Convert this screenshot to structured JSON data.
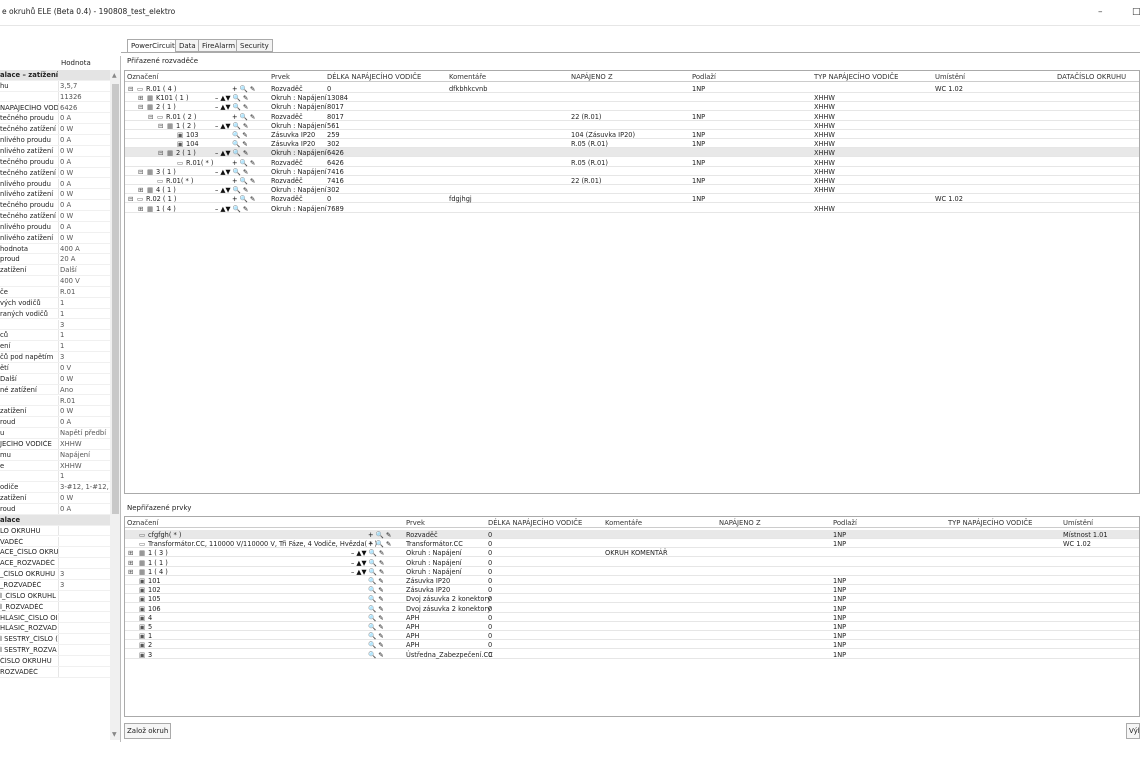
{
  "window": {
    "title": "e okruhů ELE (Beta 0.4) - 190808_test_elektro",
    "min": "–",
    "max": "□"
  },
  "tabs": [
    "PowerCircuit",
    "Data",
    "FireAlarm",
    "Security"
  ],
  "assigned_label": "Přiřazené rozvaděče",
  "unassigned_label": "Nepřiřazené prvky",
  "buttons": {
    "create_circuit": "Založ okruh",
    "right": "Výb"
  },
  "left": {
    "col_value": "Hodnota",
    "rows": [
      {
        "k": "alace – zatížení",
        "v": "",
        "cat": true
      },
      {
        "k": "hu",
        "v": "3,5,7"
      },
      {
        "k": "",
        "v": "11326"
      },
      {
        "k": "NAPÁJECÍHO VODIČ",
        "v": "6426"
      },
      {
        "k": "tečného proudu",
        "v": "0 A"
      },
      {
        "k": "tečného zatížení",
        "v": "0 W"
      },
      {
        "k": "nlivého proudu",
        "v": "0 A"
      },
      {
        "k": "nlivého zatížení",
        "v": "0 W"
      },
      {
        "k": "tečného proudu",
        "v": "0 A"
      },
      {
        "k": "tečného zatížení",
        "v": "0 W"
      },
      {
        "k": "nlivého proudu",
        "v": "0 A"
      },
      {
        "k": "nlivého zatížení",
        "v": "0 W"
      },
      {
        "k": "tečného proudu",
        "v": "0 A"
      },
      {
        "k": "tečného zatížení",
        "v": "0 W"
      },
      {
        "k": "nlivého proudu",
        "v": "0 A"
      },
      {
        "k": "nlivého zatížení",
        "v": "0 W"
      },
      {
        "k": "hodnota",
        "v": "400 A"
      },
      {
        "k": "proud",
        "v": "20 A"
      },
      {
        "k": "zatížení",
        "v": "Další"
      },
      {
        "k": "",
        "v": "400 V"
      },
      {
        "k": "če",
        "v": "R.01"
      },
      {
        "k": "vých vodičů",
        "v": "1"
      },
      {
        "k": "raných vodičů",
        "v": "1"
      },
      {
        "k": "",
        "v": "3"
      },
      {
        "k": "ců",
        "v": "1"
      },
      {
        "k": "ení",
        "v": "1"
      },
      {
        "k": "čů pod napětím",
        "v": "3"
      },
      {
        "k": "ětí",
        "v": "0 V"
      },
      {
        "k": "Další",
        "v": "0 W"
      },
      {
        "k": "né zatížení",
        "v": "Ano"
      },
      {
        "k": "",
        "v": "R.01"
      },
      {
        "k": "zatížení",
        "v": "0 W"
      },
      {
        "k": "roud",
        "v": "0 A"
      },
      {
        "k": "u",
        "v": "Napětí předbí"
      },
      {
        "k": "JECÍHO VODIČE",
        "v": "XHHW"
      },
      {
        "k": "mu",
        "v": "Napájení"
      },
      {
        "k": "e",
        "v": "XHHW"
      },
      {
        "k": "",
        "v": "1"
      },
      {
        "k": "odiče",
        "v": "3-#12, 1-#12,"
      },
      {
        "k": "zatížení",
        "v": "0 W"
      },
      {
        "k": "roud",
        "v": "0 A"
      },
      {
        "k": "alace",
        "v": "",
        "cat": true
      },
      {
        "k": "LO OKRUHU",
        "v": ""
      },
      {
        "k": "VADĚČ",
        "v": ""
      },
      {
        "k": "ACE_ČÍSLO OKRUL",
        "v": ""
      },
      {
        "k": "ACE_ROZVADĚČ",
        "v": ""
      },
      {
        "k": "_ČÍSLO OKRUHU",
        "v": "3"
      },
      {
        "k": "_ROZVADĚČ",
        "v": "3"
      },
      {
        "k": "Í_ČÍSLO OKRUHL",
        "v": ""
      },
      {
        "k": "Í_ROZVADĚČ",
        "v": ""
      },
      {
        "k": "HLÁSIČ_ČÍSLO OI",
        "v": ""
      },
      {
        "k": "HLÁSIČ_ROZVAD",
        "v": ""
      },
      {
        "k": "Í SESTRY_ČÍSLO (",
        "v": ""
      },
      {
        "k": "Í SESTRY_ROZVA",
        "v": ""
      },
      {
        "k": "ČÍSLO OKRUHU",
        "v": ""
      },
      {
        "k": "ROZVADĚČ",
        "v": ""
      }
    ]
  },
  "assigned": {
    "headers": [
      "Označení",
      "Prvek",
      "DÉLKA NAPÁJECÍHO VODIČE",
      "Komentáře",
      "NAPÁJENO Z",
      "Podlaží",
      "TYP NAPÁJECÍHO VODIČE",
      "Umístění",
      "DATAČÍSLO OKRUHU"
    ],
    "rows": [
      {
        "ind": 0,
        "exp": "⊟",
        "icon": "▭",
        "name": "R.01 ( 4 )",
        "ctrl": "+ 🔍 ✎",
        "prvek": "Rozvaděč",
        "delka": "0",
        "kom": "dfkbhkcvnb",
        "nap": "",
        "pod": "1NP",
        "typ": "",
        "um": "WC 1.02"
      },
      {
        "ind": 1,
        "exp": "⊞",
        "icon": "▦",
        "name": "K101 ( 1 )",
        "ctrl": "– ▲▼ 🔍 ✎",
        "prvek": "Okruh : Napájení",
        "delka": "13084",
        "kom": "",
        "nap": "",
        "pod": "",
        "typ": "XHHW",
        "um": ""
      },
      {
        "ind": 1,
        "exp": "⊟",
        "icon": "▦",
        "name": "2 ( 1 )",
        "ctrl": "– ▲▼ 🔍 ✎",
        "prvek": "Okruh : Napájení",
        "delka": "8017",
        "kom": "",
        "nap": "",
        "pod": "",
        "typ": "XHHW",
        "um": ""
      },
      {
        "ind": 2,
        "exp": "⊟",
        "icon": "▭",
        "name": "R.01 ( 2 )",
        "ctrl": "+ 🔍 ✎",
        "prvek": "Rozvaděč",
        "delka": "8017",
        "kom": "",
        "nap": "22 (R.01)",
        "pod": "1NP",
        "typ": "XHHW",
        "um": ""
      },
      {
        "ind": 3,
        "exp": "⊟",
        "icon": "▦",
        "name": "1 ( 2 )",
        "ctrl": "– ▲▼ 🔍 ✎",
        "prvek": "Okruh : Napájení",
        "delka": "561",
        "kom": "",
        "nap": "",
        "pod": "",
        "typ": "XHHW",
        "um": ""
      },
      {
        "ind": 4,
        "exp": "",
        "icon": "▣",
        "name": "103",
        "ctrl": "🔍 ✎",
        "prvek": "Zásuvka IP20",
        "delka": "259",
        "kom": "",
        "nap": "104 (Zásuvka IP20)",
        "pod": "1NP",
        "typ": "XHHW",
        "um": ""
      },
      {
        "ind": 4,
        "exp": "",
        "icon": "▣",
        "name": "104",
        "ctrl": "🔍 ✎",
        "prvek": "Zásuvka IP20",
        "delka": "302",
        "kom": "",
        "nap": "R.05 (R.01)",
        "pod": "1NP",
        "typ": "XHHW",
        "um": ""
      },
      {
        "ind": 3,
        "exp": "⊟",
        "icon": "▦",
        "name": "2 ( 1 )",
        "ctrl": "– ▲▼ 🔍 ✎",
        "prvek": "Okruh : Napájení",
        "delka": "6426",
        "kom": "",
        "nap": "",
        "pod": "",
        "typ": "XHHW",
        "um": "",
        "sel": true
      },
      {
        "ind": 4,
        "exp": "",
        "icon": "▭",
        "name": "R.01( * )",
        "ctrl": "+ 🔍 ✎",
        "prvek": "Rozvaděč",
        "delka": "6426",
        "kom": "",
        "nap": "R.05 (R.01)",
        "pod": "1NP",
        "typ": "XHHW",
        "um": ""
      },
      {
        "ind": 1,
        "exp": "⊟",
        "icon": "▦",
        "name": "3 ( 1 )",
        "ctrl": "– ▲▼ 🔍 ✎",
        "prvek": "Okruh : Napájení",
        "delka": "7416",
        "kom": "",
        "nap": "",
        "pod": "",
        "typ": "XHHW",
        "um": ""
      },
      {
        "ind": 2,
        "exp": "",
        "icon": "▭",
        "name": "R.01( * )",
        "ctrl": "+ 🔍 ✎",
        "prvek": "Rozvaděč",
        "delka": "7416",
        "kom": "",
        "nap": "22 (R.01)",
        "pod": "1NP",
        "typ": "XHHW",
        "um": ""
      },
      {
        "ind": 1,
        "exp": "⊞",
        "icon": "▦",
        "name": "4 ( 1 )",
        "ctrl": "– ▲▼ 🔍 ✎",
        "prvek": "Okruh : Napájení",
        "delka": "302",
        "kom": "",
        "nap": "",
        "pod": "",
        "typ": "XHHW",
        "um": ""
      },
      {
        "ind": 0,
        "exp": "⊟",
        "icon": "▭",
        "name": "R.02 ( 1 )",
        "ctrl": "+ 🔍 ✎",
        "prvek": "Rozvaděč",
        "delka": "0",
        "kom": "fdgjhgj",
        "nap": "",
        "pod": "1NP",
        "typ": "",
        "um": "WC 1.02"
      },
      {
        "ind": 1,
        "exp": "⊞",
        "icon": "▦",
        "name": "1 ( 4 )",
        "ctrl": "– ▲▼ 🔍 ✎",
        "prvek": "Okruh : Napájení",
        "delka": "7689",
        "kom": "",
        "nap": "",
        "pod": "",
        "typ": "XHHW",
        "um": ""
      }
    ]
  },
  "unassigned": {
    "headers": [
      "Označení",
      "Prvek",
      "DÉLKA NAPÁJECÍHO VODIČE",
      "Komentáře",
      "NAPÁJENO Z",
      "Podlaží",
      "TYP NAPÁJECÍHO VODIČE",
      "Umístění"
    ],
    "rows": [
      {
        "exp": "",
        "icon": "▭",
        "name": "cfgfgh( * )",
        "ctrl": "+ 🔍 ✎",
        "prvek": "Rozvaděč",
        "delka": "0",
        "kom": "",
        "pod": "1NP",
        "um": "Místnost 1.01",
        "sel": true
      },
      {
        "exp": "",
        "icon": "▭",
        "name": "Transformátor.CC, 110000 V/110000 V, Tři Fáze, 4 Vodiče, Hvězda( * )",
        "ctrl": "+ 🔍 ✎",
        "prvek": "Transformátor.CC",
        "delka": "0",
        "kom": "",
        "pod": "1NP",
        "um": "WC 1.02"
      },
      {
        "exp": "⊞",
        "icon": "▦",
        "name": "1 ( 3 )",
        "ctrl": "– ▲▼ 🔍 ✎",
        "prvek": "Okruh : Napájení",
        "delka": "0",
        "kom": "OKRUH KOMENTÁŘ",
        "pod": "",
        "um": ""
      },
      {
        "exp": "⊞",
        "icon": "▦",
        "name": "1 ( 1 )",
        "ctrl": "– ▲▼ 🔍 ✎",
        "prvek": "Okruh : Napájení",
        "delka": "0",
        "kom": "",
        "pod": "",
        "um": ""
      },
      {
        "exp": "⊞",
        "icon": "▦",
        "name": "1 ( 4 )",
        "ctrl": "– ▲▼ 🔍 ✎",
        "prvek": "Okruh : Napájení",
        "delka": "0",
        "kom": "",
        "pod": "",
        "um": ""
      },
      {
        "exp": "",
        "icon": "▣",
        "name": "101",
        "ctrl": "🔍 ✎",
        "prvek": "Zásuvka IP20",
        "delka": "0",
        "kom": "",
        "pod": "1NP",
        "um": ""
      },
      {
        "exp": "",
        "icon": "▣",
        "name": "102",
        "ctrl": "🔍 ✎",
        "prvek": "Zásuvka IP20",
        "delka": "0",
        "kom": "",
        "pod": "1NP",
        "um": ""
      },
      {
        "exp": "",
        "icon": "▣",
        "name": "105",
        "ctrl": "🔍 ✎",
        "prvek": "Dvoj zásuvka 2 konektory",
        "delka": "0",
        "kom": "",
        "pod": "1NP",
        "um": ""
      },
      {
        "exp": "",
        "icon": "▣",
        "name": "106",
        "ctrl": "🔍 ✎",
        "prvek": "Dvoj zásuvka 2 konektory",
        "delka": "0",
        "kom": "",
        "pod": "1NP",
        "um": ""
      },
      {
        "exp": "",
        "icon": "▣",
        "name": "4",
        "ctrl": "🔍 ✎",
        "prvek": "APH",
        "delka": "0",
        "kom": "",
        "pod": "1NP",
        "um": ""
      },
      {
        "exp": "",
        "icon": "▣",
        "name": "5",
        "ctrl": "🔍 ✎",
        "prvek": "APH",
        "delka": "0",
        "kom": "",
        "pod": "1NP",
        "um": ""
      },
      {
        "exp": "",
        "icon": "▣",
        "name": "1",
        "ctrl": "🔍 ✎",
        "prvek": "APH",
        "delka": "0",
        "kom": "",
        "pod": "1NP",
        "um": ""
      },
      {
        "exp": "",
        "icon": "▣",
        "name": "2",
        "ctrl": "🔍 ✎",
        "prvek": "APH",
        "delka": "0",
        "kom": "",
        "pod": "1NP",
        "um": ""
      },
      {
        "exp": "",
        "icon": "▣",
        "name": "3",
        "ctrl": "🔍 ✎",
        "prvek": "Ústředna_Zabezpečení.CC",
        "delka": "0",
        "kom": "",
        "pod": "1NP",
        "um": ""
      }
    ]
  }
}
